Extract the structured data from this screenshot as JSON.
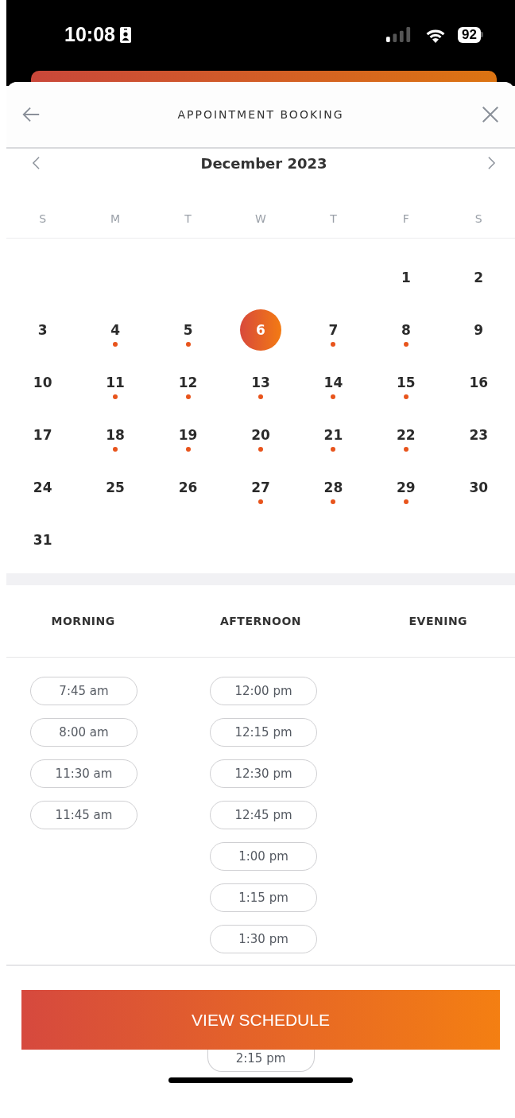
{
  "status_bar": {
    "time": "10:08",
    "battery": "92"
  },
  "header": {
    "title": "APPOINTMENT BOOKING"
  },
  "calendar": {
    "month": "December 2023",
    "weekdays": [
      "S",
      "M",
      "T",
      "W",
      "T",
      "F",
      "S"
    ],
    "weeks": [
      [
        {
          "kind": "empty"
        },
        {
          "kind": "empty"
        },
        {
          "kind": "empty"
        },
        {
          "kind": "empty"
        },
        {
          "kind": "empty"
        },
        {
          "kind": "date",
          "day": "1",
          "available": false,
          "selected": false
        },
        {
          "kind": "date",
          "day": "2",
          "available": false,
          "selected": false
        }
      ],
      [
        {
          "kind": "date",
          "day": "3",
          "available": false,
          "selected": false
        },
        {
          "kind": "date",
          "day": "4",
          "available": true,
          "selected": false
        },
        {
          "kind": "date",
          "day": "5",
          "available": true,
          "selected": false
        },
        {
          "kind": "date",
          "day": "6",
          "available": false,
          "selected": true
        },
        {
          "kind": "date",
          "day": "7",
          "available": true,
          "selected": false
        },
        {
          "kind": "date",
          "day": "8",
          "available": true,
          "selected": false
        },
        {
          "kind": "date",
          "day": "9",
          "available": false,
          "selected": false
        }
      ],
      [
        {
          "kind": "date",
          "day": "10",
          "available": false,
          "selected": false
        },
        {
          "kind": "date",
          "day": "11",
          "available": true,
          "selected": false
        },
        {
          "kind": "date",
          "day": "12",
          "available": true,
          "selected": false
        },
        {
          "kind": "date",
          "day": "13",
          "available": true,
          "selected": false
        },
        {
          "kind": "date",
          "day": "14",
          "available": true,
          "selected": false
        },
        {
          "kind": "date",
          "day": "15",
          "available": true,
          "selected": false
        },
        {
          "kind": "date",
          "day": "16",
          "available": false,
          "selected": false
        }
      ],
      [
        {
          "kind": "date",
          "day": "17",
          "available": false,
          "selected": false
        },
        {
          "kind": "date",
          "day": "18",
          "available": true,
          "selected": false
        },
        {
          "kind": "date",
          "day": "19",
          "available": true,
          "selected": false
        },
        {
          "kind": "date",
          "day": "20",
          "available": true,
          "selected": false
        },
        {
          "kind": "date",
          "day": "21",
          "available": true,
          "selected": false
        },
        {
          "kind": "date",
          "day": "22",
          "available": true,
          "selected": false
        },
        {
          "kind": "date",
          "day": "23",
          "available": false,
          "selected": false
        }
      ],
      [
        {
          "kind": "date",
          "day": "24",
          "available": false,
          "selected": false
        },
        {
          "kind": "date",
          "day": "25",
          "available": false,
          "selected": false
        },
        {
          "kind": "date",
          "day": "26",
          "available": false,
          "selected": false
        },
        {
          "kind": "date",
          "day": "27",
          "available": true,
          "selected": false
        },
        {
          "kind": "date",
          "day": "28",
          "available": true,
          "selected": false
        },
        {
          "kind": "date",
          "day": "29",
          "available": true,
          "selected": false
        },
        {
          "kind": "date",
          "day": "30",
          "available": false,
          "selected": false
        }
      ],
      [
        {
          "kind": "date",
          "day": "31",
          "available": false,
          "selected": false
        }
      ]
    ]
  },
  "periods": [
    {
      "heading": "MORNING",
      "slots": [
        "7:45 am",
        "8:00 am",
        "11:30 am",
        "11:45 am"
      ]
    },
    {
      "heading": "AFTERNOON",
      "slots": [
        "12:00 pm",
        "12:15 pm",
        "12:30 pm",
        "12:45 pm",
        "1:00 pm",
        "1:15 pm",
        "1:30 pm"
      ]
    },
    {
      "heading": "EVENING"
    }
  ],
  "button": {
    "label": "VIEW SCHEDULE"
  },
  "peeking_slot": "2:15 pm"
}
